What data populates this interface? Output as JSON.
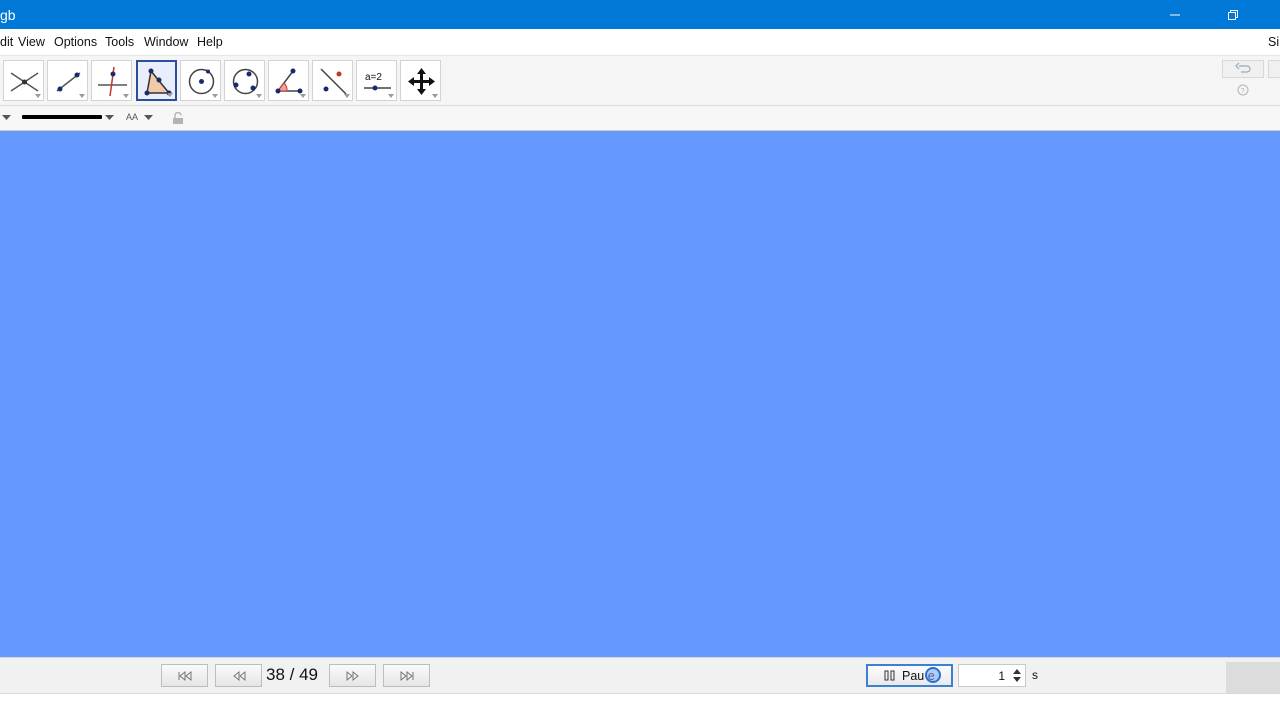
{
  "window": {
    "title": "gb"
  },
  "menu": {
    "items": [
      "dit",
      "View",
      "Options",
      "Tools",
      "Window",
      "Help"
    ],
    "right_label": "Si"
  },
  "toolbar": {
    "selected_index": 3,
    "tools": [
      {
        "icon": "intersect-icon"
      },
      {
        "icon": "line-icon"
      },
      {
        "icon": "perpendicular-line-icon"
      },
      {
        "icon": "polygon-icon"
      },
      {
        "icon": "circle-center-point-icon"
      },
      {
        "icon": "circle-three-points-icon"
      },
      {
        "icon": "angle-icon"
      },
      {
        "icon": "reflect-icon"
      },
      {
        "icon": "slider-icon",
        "text": "a=2"
      },
      {
        "icon": "move-graphics-view-icon"
      }
    ]
  },
  "stylebar": {
    "font_label": "AA"
  },
  "canvas": {
    "background": "#6699ff"
  },
  "navigation": {
    "current_step": 38,
    "total_steps": 49,
    "step_text": "38 / 49",
    "pause_label": "Pau e",
    "speed_value": "1",
    "speed_unit": "s"
  },
  "colors": {
    "titlebar": "#0078d7",
    "canvas": "#6699ff",
    "accent": "#3c7fd6"
  }
}
